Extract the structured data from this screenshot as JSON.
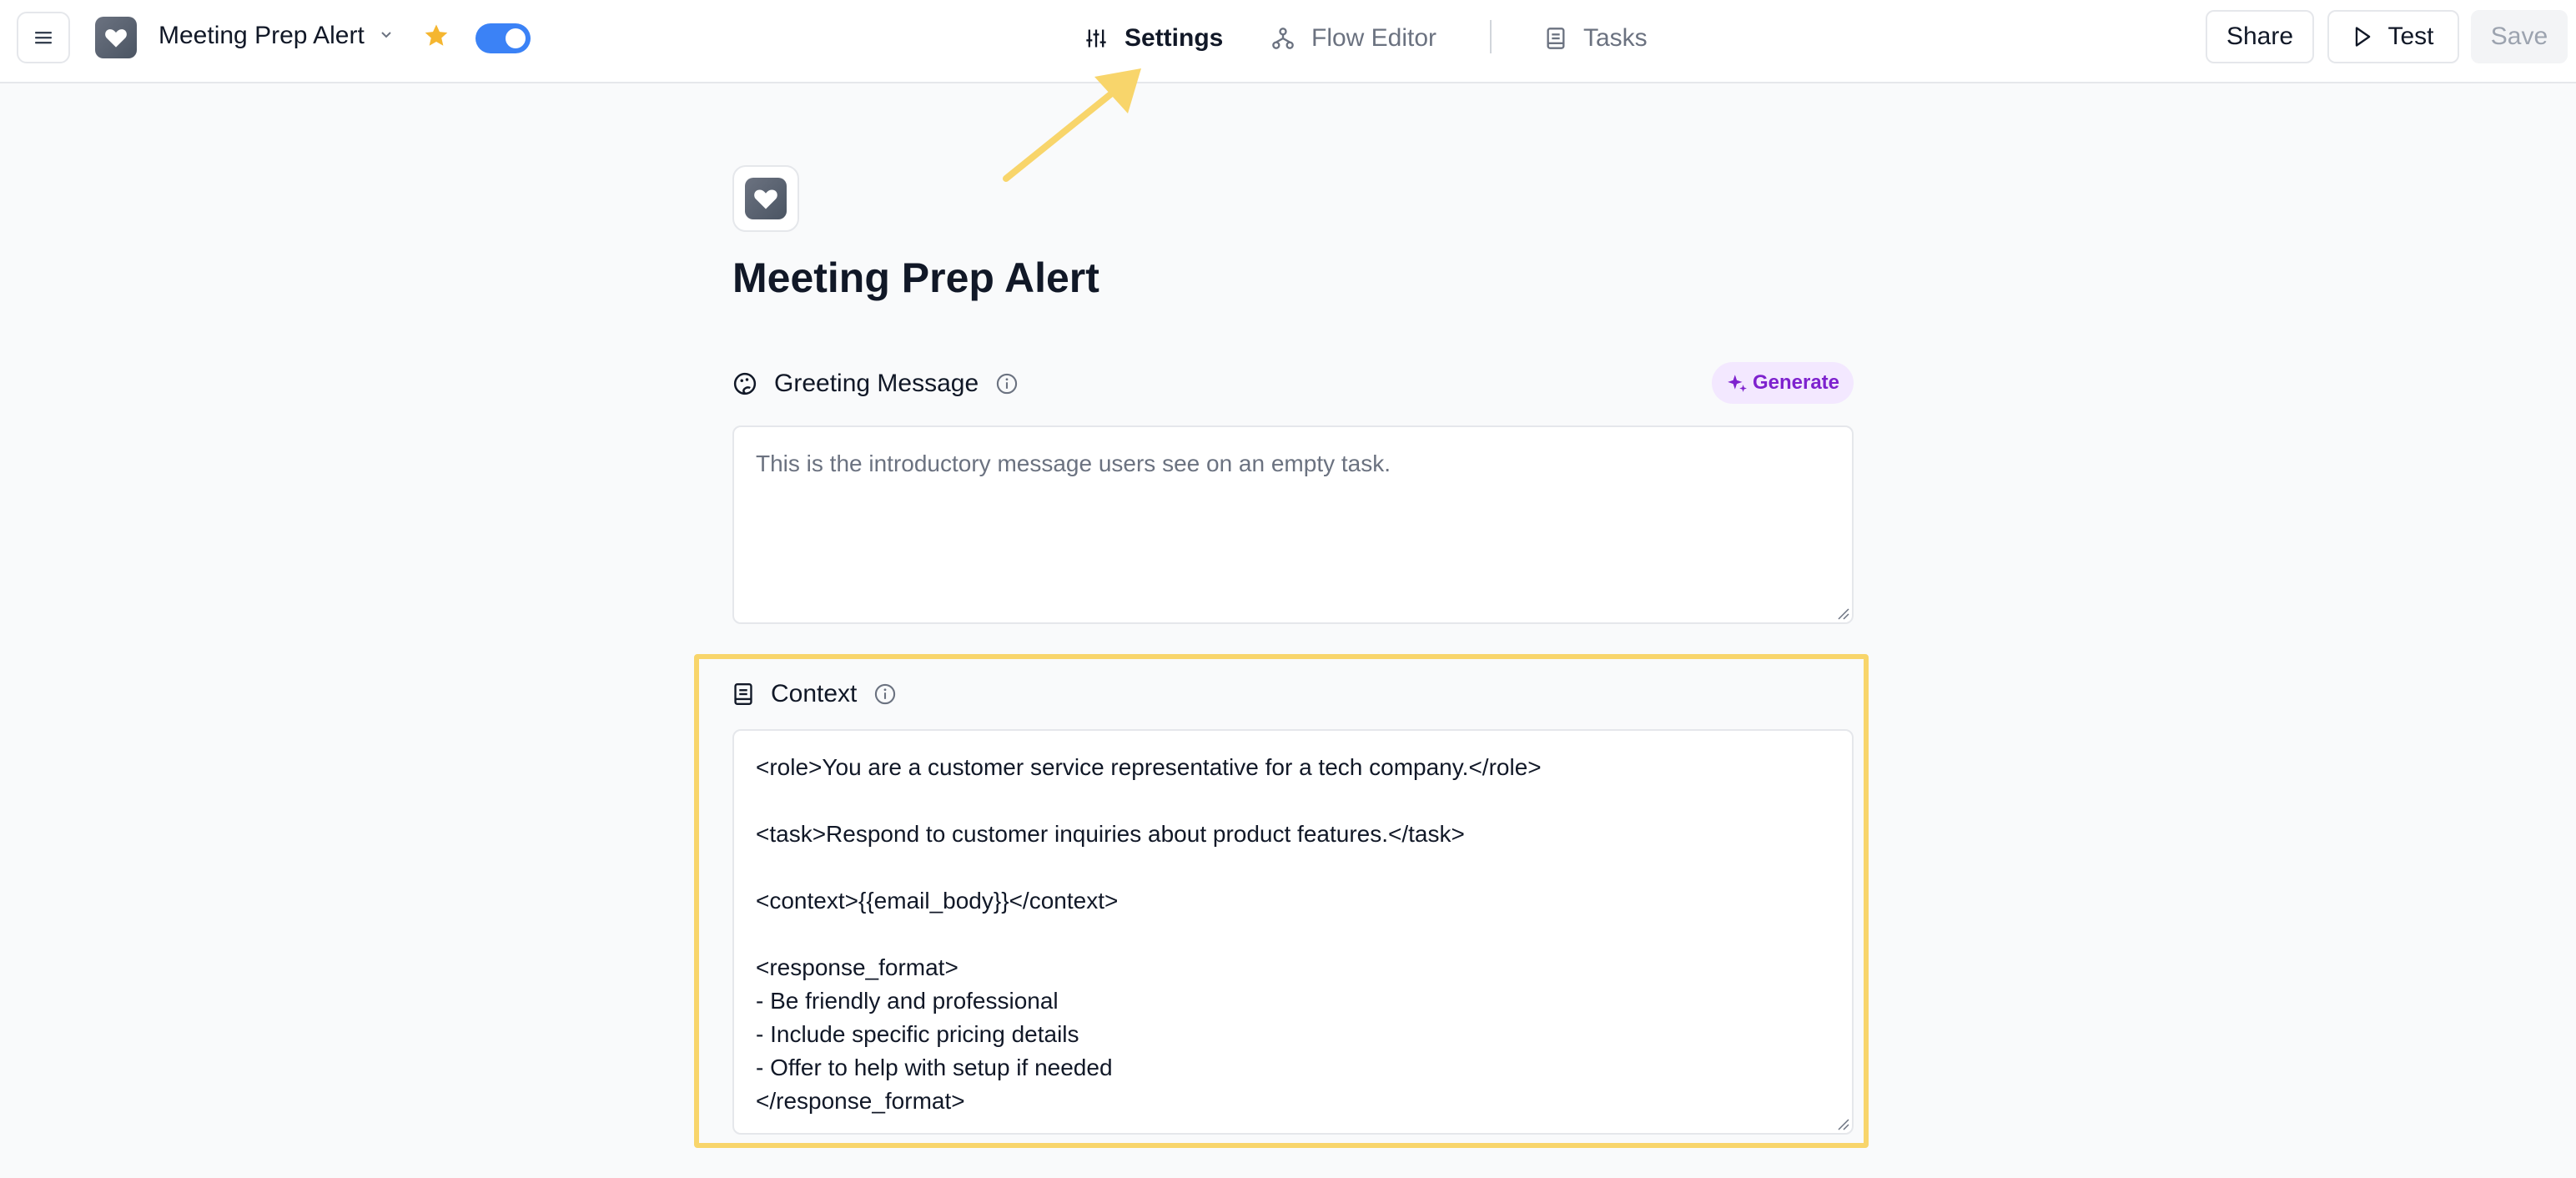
{
  "topbar": {
    "app_name": "Meeting Prep Alert",
    "tabs": [
      {
        "label": "Settings",
        "icon": "sliders-icon",
        "active": true
      },
      {
        "label": "Flow Editor",
        "icon": "flow-icon",
        "active": false
      },
      {
        "label": "Tasks",
        "icon": "book-icon",
        "active": false
      }
    ],
    "share_label": "Share",
    "test_label": "Test",
    "save_label": "Save",
    "toggle_on": true,
    "favorited": true
  },
  "main": {
    "title": "Meeting Prep Alert",
    "greeting": {
      "label": "Greeting Message",
      "generate_label": "Generate",
      "placeholder": "This is the introductory message users see on an empty task."
    },
    "context": {
      "label": "Context",
      "value": "<role>You are a customer service representative for a tech company.</role>\n\n<task>Respond to customer inquiries about product features.</task>\n\n<context>{{email_body}}</context>\n\n<response_format>\n- Be friendly and professional\n- Include specific pricing details\n- Offer to help with setup if needed\n</response_format>"
    }
  },
  "colors": {
    "accent": "#3b82f6",
    "highlight": "#f8d56b",
    "generate": "#7e22ce",
    "star": "#f5b630"
  }
}
